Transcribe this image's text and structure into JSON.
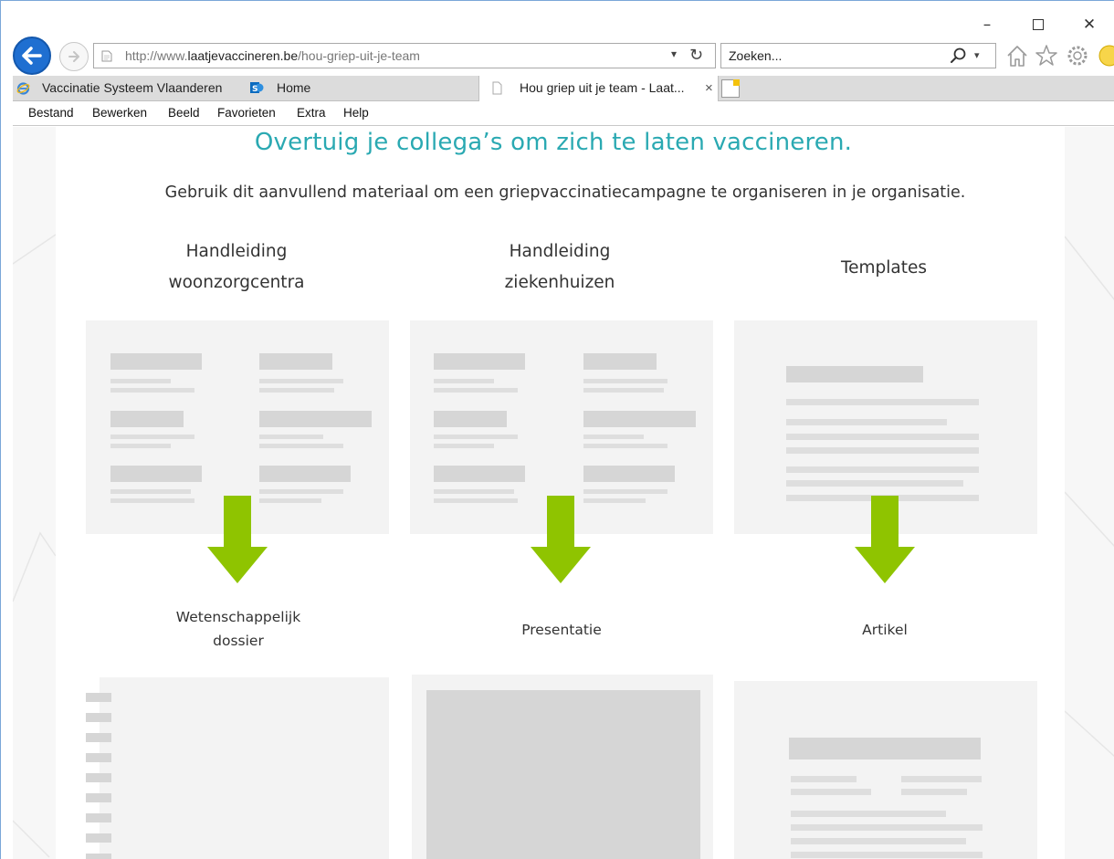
{
  "browser": {
    "url_prefix": "http://www.",
    "url_domain": "laatjevaccineren.be",
    "url_path": "/hou-griep-uit-je-team",
    "search_placeholder": "Zoeken...",
    "window_controls": {
      "minimize": "–",
      "close": "✕"
    },
    "tabs": [
      {
        "label": "Vaccinatie Systeem Vlaanderen",
        "icon": "ie-icon"
      },
      {
        "label": "Home",
        "icon": "sharepoint-icon"
      },
      {
        "label": "Hou griep uit je team - Laat...",
        "icon": "page-icon",
        "close": "×"
      }
    ],
    "menu": [
      "Bestand",
      "Bewerken",
      "Beeld",
      "Favorieten",
      "Extra",
      "Help"
    ],
    "toolbar_icons": [
      "home-icon",
      "star-icon",
      "gear-icon",
      "smiley-icon"
    ]
  },
  "page": {
    "heading": "Overtuig je collega’s om zich te laten vaccineren.",
    "intro": "Gebruik dit aanvullend materiaal om een griepvaccinatiecampagne te organiseren in je organisatie.",
    "columns": [
      {
        "title_line1": "Handleiding",
        "title_line2": "woonzorgcentra",
        "result_line1": "Wetenschappelijk",
        "result_line2": "dossier"
      },
      {
        "title_line1": "Handleiding",
        "title_line2": "ziekenhuizen",
        "result_line1": "Presentatie",
        "result_line2": ""
      },
      {
        "title_line1": "Templates",
        "title_line2": "",
        "result_line1": "Artikel",
        "result_line2": ""
      }
    ],
    "arrow_color": "#8fc400",
    "heading_color": "#2aa9b2"
  }
}
